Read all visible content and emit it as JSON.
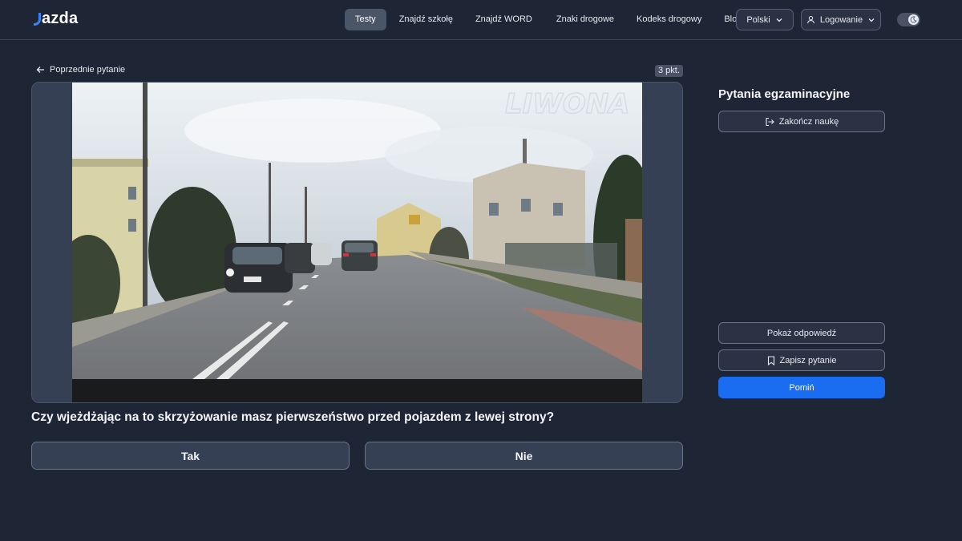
{
  "header": {
    "logo": "azda",
    "nav": [
      {
        "label": "Testy",
        "active": true
      },
      {
        "label": "Znajdź szkołę"
      },
      {
        "label": "Znajdź WORD"
      },
      {
        "label": "Znaki drogowe"
      },
      {
        "label": "Kodeks drogowy"
      },
      {
        "label": "Blog"
      }
    ],
    "language": "Polski",
    "login": "Logowanie",
    "theme_toggle_icon": "moon-icon"
  },
  "question": {
    "back_label": "Poprzednie pytanie",
    "points": "3 pkt.",
    "watermark": "LIWONA",
    "text": "Czy wjeżdżając na to skrzyżowanie masz pierwszeństwo przed pojazdem z lewej strony?",
    "answers": [
      "Tak",
      "Nie"
    ]
  },
  "sidebar": {
    "title": "Pytania egzaminacyjne",
    "finish_label": "Zakończ naukę",
    "show_answer_label": "Pokaż odpowiedź",
    "save_label": "Zapisz pytanie",
    "skip_label": "Pomiń"
  },
  "colors": {
    "background": "#1e2535",
    "panel": "#364055",
    "accent": "#1a6cf0"
  }
}
